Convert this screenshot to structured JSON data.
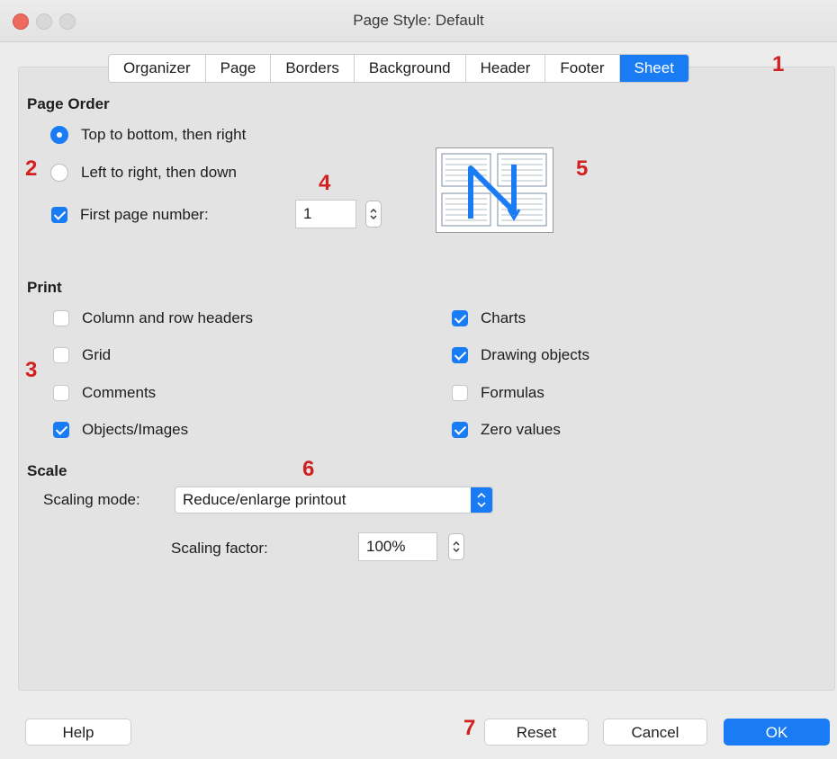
{
  "window": {
    "title": "Page Style: Default"
  },
  "tabs": [
    "Organizer",
    "Page",
    "Borders",
    "Background",
    "Header",
    "Footer",
    "Sheet"
  ],
  "active_tab": "Sheet",
  "annotations": [
    "1",
    "2",
    "3",
    "4",
    "5",
    "6",
    "7"
  ],
  "page_order": {
    "heading": "Page Order",
    "top_to_bottom": "Top to bottom, then right",
    "left_to_right": "Left to right, then down",
    "first_page_number_label": "First page number:",
    "first_page_number_value": "1",
    "selected": "top_to_bottom",
    "first_page_number_checked": true
  },
  "print": {
    "heading": "Print",
    "items": [
      {
        "label": "Column and row headers",
        "checked": false
      },
      {
        "label": "Grid",
        "checked": false
      },
      {
        "label": "Comments",
        "checked": false
      },
      {
        "label": "Objects/Images",
        "checked": true
      },
      {
        "label": "Charts",
        "checked": true
      },
      {
        "label": "Drawing objects",
        "checked": true
      },
      {
        "label": "Formulas",
        "checked": false
      },
      {
        "label": "Zero values",
        "checked": true
      }
    ]
  },
  "scale": {
    "heading": "Scale",
    "mode_label": "Scaling mode:",
    "mode_value": "Reduce/enlarge printout",
    "factor_label": "Scaling factor:",
    "factor_value": "100%"
  },
  "buttons": {
    "help": "Help",
    "reset": "Reset",
    "cancel": "Cancel",
    "ok": "OK"
  },
  "colors": {
    "accent": "#1a7cf5",
    "annotation": "#d21f1f"
  }
}
